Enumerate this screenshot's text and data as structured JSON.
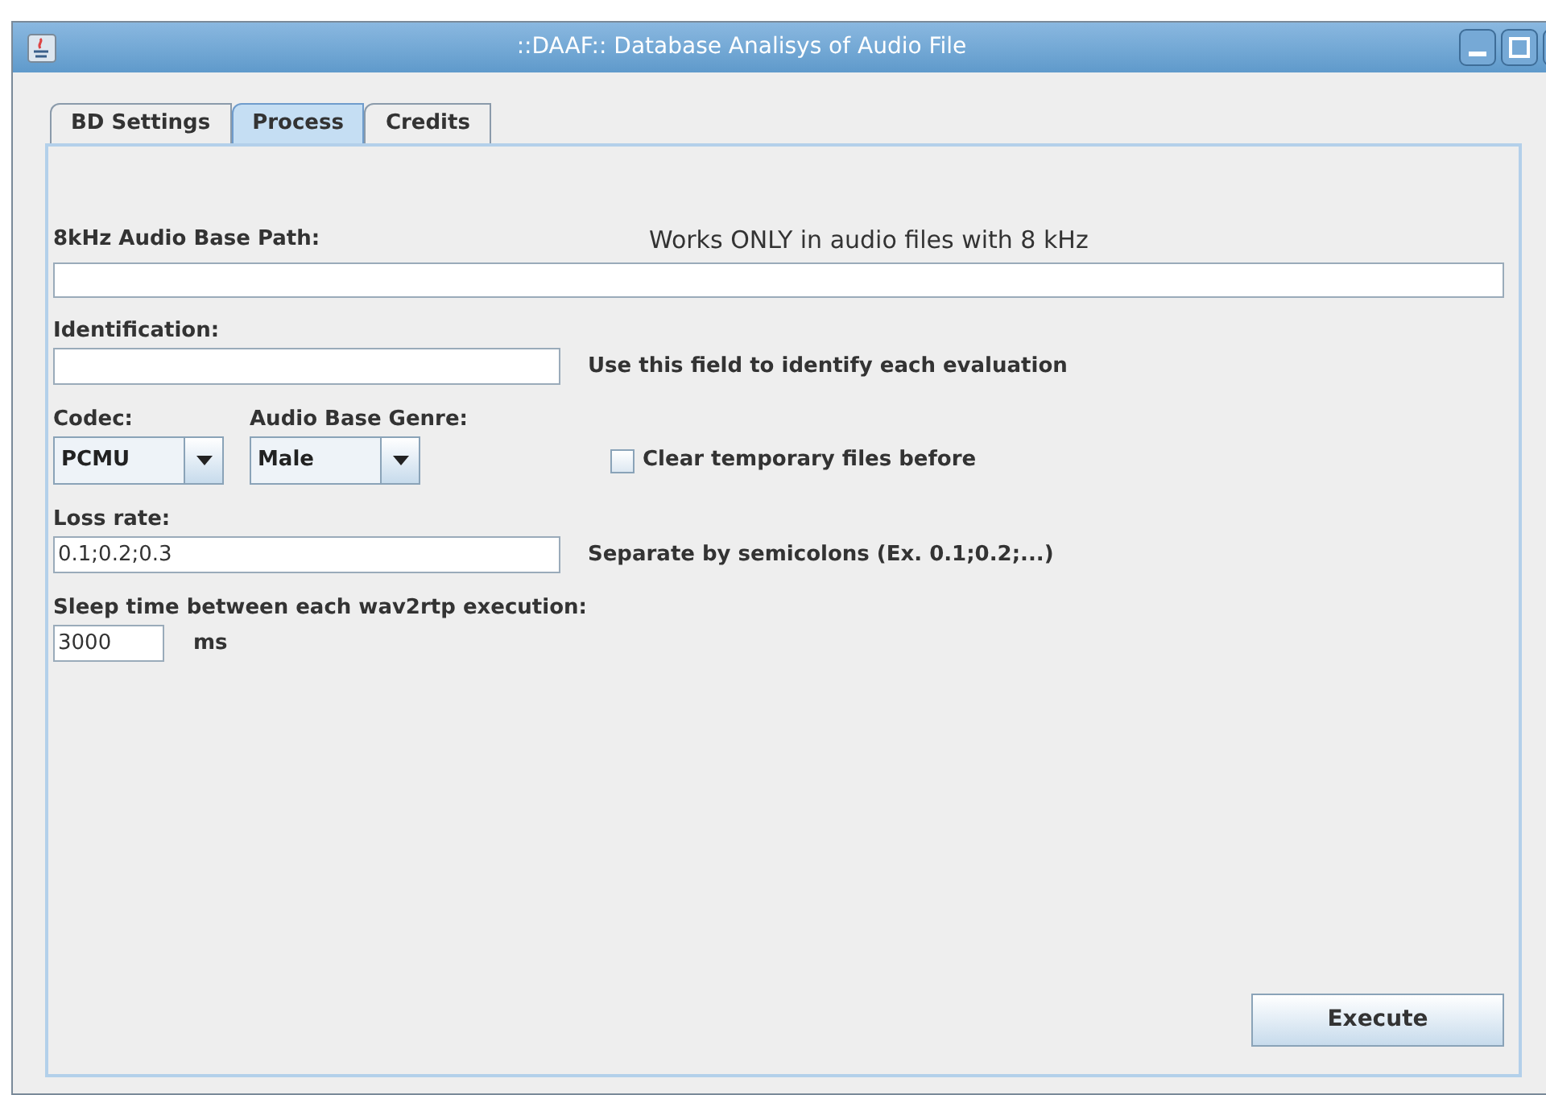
{
  "window": {
    "title": "::DAAF:: Database Analisys of Audio File"
  },
  "tabs": [
    {
      "label": "BD Settings",
      "selected": false
    },
    {
      "label": "Process",
      "selected": true
    },
    {
      "label": "Credits",
      "selected": false
    }
  ],
  "path": {
    "label": "8kHz Audio Base Path:",
    "note": "Works ONLY in audio files with 8 kHz"
  },
  "identification": {
    "label": "Identification:",
    "hint": "Use this field to identify each evaluation"
  },
  "codec": {
    "label": "Codec:",
    "value": "PCMU"
  },
  "genre": {
    "label": "Audio Base Genre:",
    "value": "Male"
  },
  "clear_temp": {
    "label": "Clear temporary files before",
    "checked": false
  },
  "loss_rate": {
    "label": "Loss rate:",
    "value": "0.1;0.2;0.3",
    "hint": "Separate by semicolons (Ex. 0.1;0.2;...)"
  },
  "sleep": {
    "label": "Sleep time between each wav2rtp execution:",
    "value": "3000",
    "unit": "ms"
  },
  "buttons": [
    "Execute"
  ]
}
